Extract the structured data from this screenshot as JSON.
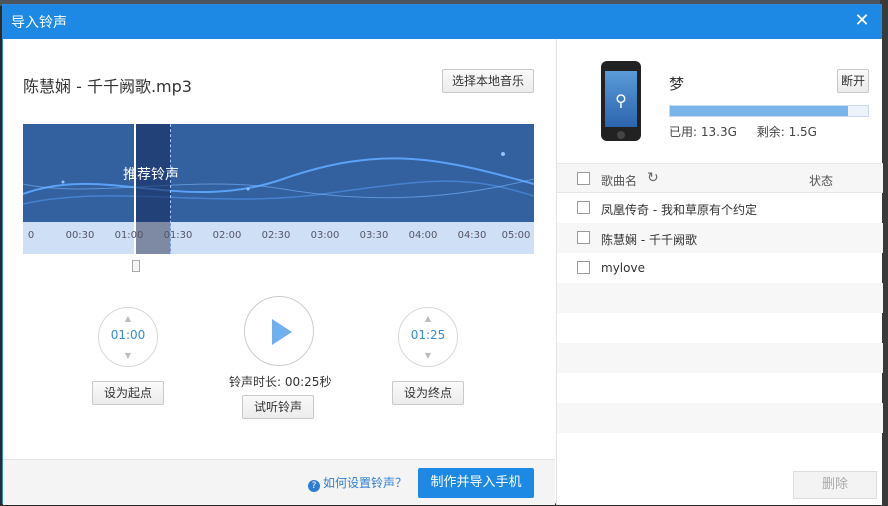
{
  "window": {
    "title": "导入铃声"
  },
  "editor": {
    "file_name": "陈慧娴 - 千千阙歌.mp3",
    "select_local_label": "选择本地音乐",
    "recommend_label": "推荐铃声",
    "ticks": [
      "0",
      "00:30",
      "01:00",
      "01:30",
      "02:00",
      "02:30",
      "03:00",
      "03:30",
      "04:00",
      "04:30",
      "05:00"
    ],
    "start_time": "01:00",
    "end_time": "01:25",
    "set_start_label": "设为起点",
    "set_end_label": "设为终点",
    "duration_text": "铃声时长: 00:25秒",
    "preview_label": "试听铃声"
  },
  "footer": {
    "howto_label": "如何设置铃声？",
    "make_import_label": "制作并导入手机"
  },
  "device": {
    "name": "梦",
    "disconnect_label": "断开",
    "used_label": "已用: 13.3G",
    "free_label": "剩余: 1.5G",
    "used_fraction": 0.9
  },
  "song_list": {
    "col_name": "歌曲名",
    "col_status": "状态",
    "rows": [
      "凤凰传奇 - 我和草原有个约定",
      "陈慧娴 - 千千阙歌",
      "mylove"
    ],
    "delete_label": "删除"
  },
  "colors": {
    "accent": "#1e88e5",
    "wave_bg": "#33609f"
  }
}
